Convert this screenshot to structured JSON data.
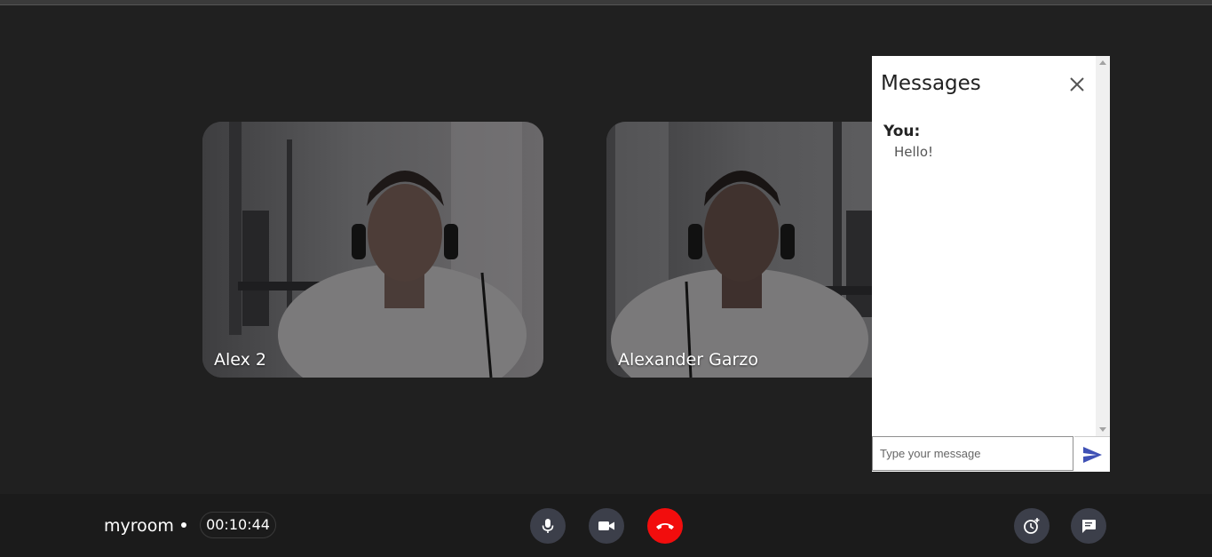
{
  "tiles": [
    {
      "name": "Alex 2"
    },
    {
      "name": "Alexander Garzo"
    }
  ],
  "chat": {
    "title": "Messages",
    "messages": [
      {
        "sender": "You:",
        "text": "Hello!"
      }
    ],
    "input_placeholder": "Type your message",
    "input_value": ""
  },
  "controls": {
    "room_name": "myroom",
    "timer": "00:10:44",
    "buttons": [
      "mic-icon",
      "camera-icon",
      "hang-up-icon",
      "timer-add-icon",
      "chat-icon"
    ]
  },
  "colors": {
    "background": "#202020",
    "bar": "#1b1b1b",
    "button": "#3c3f4a",
    "hangup": "#f20d0d",
    "send": "#3f51b5"
  }
}
